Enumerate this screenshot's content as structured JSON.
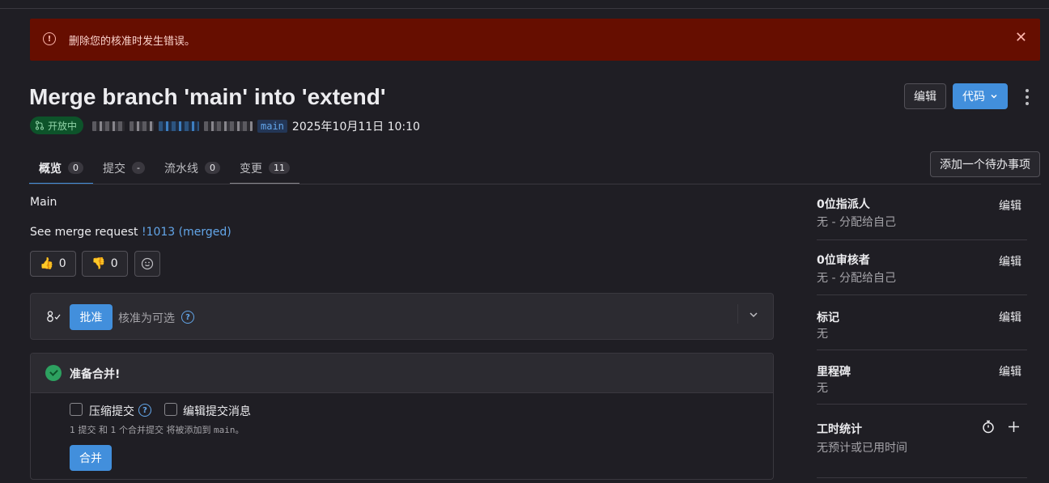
{
  "alert": {
    "message": "删除您的核准时发生错误。",
    "icon": "error-icon",
    "close_icon": "close-icon"
  },
  "header": {
    "title": "Merge branch 'main' into 'extend'",
    "edit_label": "编辑",
    "code_label": "代码",
    "status": "开放中",
    "target_branch": "main",
    "datetime": "2025年10月11日 10:10"
  },
  "tabs": [
    {
      "label": "概览",
      "count": "0"
    },
    {
      "label": "提交",
      "count": "-"
    },
    {
      "label": "流水线",
      "count": "0"
    },
    {
      "label": "变更",
      "count": "11"
    }
  ],
  "add_todo": "添加一个待办事项",
  "description": {
    "line1": "Main",
    "line2_prefix": "See merge request ",
    "link": "!1013 (merged)"
  },
  "reactions": {
    "thumbs_up": "0",
    "thumbs_down": "0"
  },
  "approval": {
    "button": "批准",
    "text": "核准为可选"
  },
  "merge_widget": {
    "title": "准备合并!",
    "squash_label": "压缩提交",
    "edit_msg_label": "编辑提交消息",
    "summary_prefix": "1 提交 和 1 个合并提交 将被添加到 ",
    "summary_branch": "main",
    "summary_suffix": "。",
    "merge_button": "合并"
  },
  "sidebar": {
    "assignees": {
      "title": "0位指派人",
      "value": "无 - 分配给自己",
      "edit": "编辑"
    },
    "reviewers": {
      "title": "0位审核者",
      "value": "无 - 分配给自己",
      "edit": "编辑"
    },
    "labels": {
      "title": "标记",
      "value": "无",
      "edit": "编辑"
    },
    "milestone": {
      "title": "里程碑",
      "value": "无",
      "edit": "编辑"
    },
    "time_tracking": {
      "title": "工时统计",
      "value": "无预计或已用时间"
    }
  },
  "colors": {
    "accent": "#428fdc",
    "alert_bg": "#660e00",
    "status_bg": "#0d532a",
    "page_bg": "#1f1e24"
  }
}
